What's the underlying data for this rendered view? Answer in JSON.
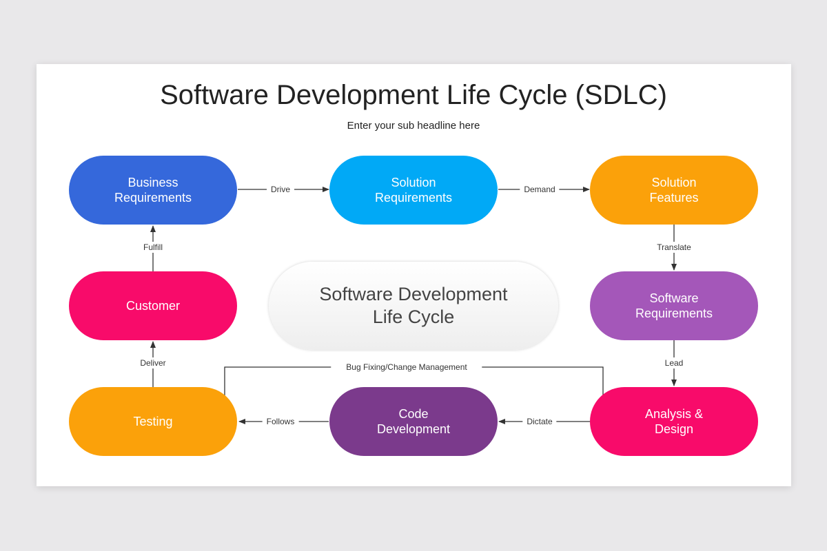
{
  "title": "Software Development Life Cycle (SDLC)",
  "subtitle": "Enter your sub headline here",
  "center": "Software Development\nLife Cycle",
  "nodes": {
    "business_requirements": {
      "label": "Business\nRequirements",
      "color": "#3568db"
    },
    "solution_requirements": {
      "label": "Solution\nRequirements",
      "color": "#01a9f6"
    },
    "solution_features": {
      "label": "Solution\nFeatures",
      "color": "#fba10a"
    },
    "customer": {
      "label": "Customer",
      "color": "#f80b6a"
    },
    "software_requirements": {
      "label": "Software\nRequirements",
      "color": "#a457b9"
    },
    "testing": {
      "label": "Testing",
      "color": "#fba10a"
    },
    "code_development": {
      "label": "Code\nDevelopment",
      "color": "#7b3a8c"
    },
    "analysis_design": {
      "label": "Analysis &\nDesign",
      "color": "#f80b6a"
    }
  },
  "edges": {
    "drive": "Drive",
    "demand": "Demand",
    "translate": "Translate",
    "lead": "Lead",
    "dictate": "Dictate",
    "follows": "Follows",
    "deliver": "Deliver",
    "fulfill": "Fulfill",
    "bug_fixing": "Bug Fixing/Change Management"
  }
}
